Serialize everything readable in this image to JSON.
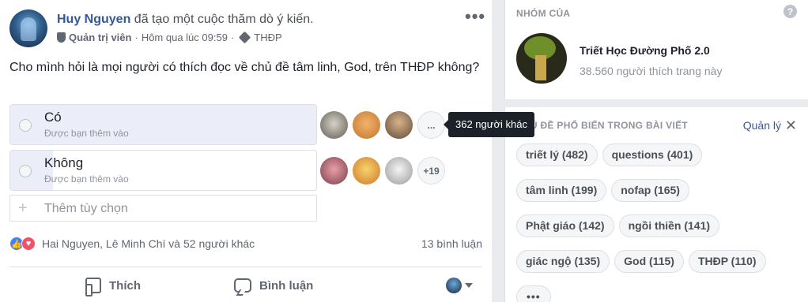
{
  "post": {
    "author": "Huy Nguyen",
    "action": " đã tạo một cuộc thăm dò ý kiến.",
    "role": "Quản trị viên",
    "separator": " · ",
    "time": "Hôm qua lúc 09:59",
    "dot": " · ",
    "tag": "THĐP",
    "more_icon": "•••",
    "question": "Cho mình hỏi là mọi người có thích đọc về chủ đề tâm linh, God, trên THĐP không?"
  },
  "poll": {
    "options": [
      {
        "label": "Có",
        "added_by": "Được bạn thêm vào",
        "more_label": "..."
      },
      {
        "label": "Không",
        "added_by": "Được bạn thêm vào",
        "more_label": "+19"
      }
    ],
    "add_placeholder": "Thêm tùy chọn",
    "add_icon": "+",
    "tooltip": "362 người khác"
  },
  "reactions": {
    "like_glyph": "👍",
    "love_glyph": "♥",
    "names": "Hai Nguyen, Lê Minh Chí và 52 người khác",
    "comments": "13 bình luận"
  },
  "actions": {
    "like": "Thích",
    "comment": "Bình luận"
  },
  "sidebar": {
    "heading": "NHÓM CỦA",
    "help_icon": "?",
    "group_name": "Triết Học Đường Phố 2.0",
    "group_likes": "38.560 người thích trang này",
    "topics_heading": "CHỦ ĐỀ PHỔ BIẾN TRONG BÀI VIẾT",
    "manage": "Quản lý",
    "close_icon": "✕",
    "more_label": "•••",
    "topics": [
      "triết lý (482)",
      "questions (401)",
      "tâm linh (199)",
      "nofap (165)",
      "Phật giáo (142)",
      "ngồi thiền (141)",
      "giác ngộ (135)",
      "God (115)",
      "THĐP (110)"
    ]
  },
  "colors": {
    "link": "#365899",
    "like_blue": "#4080ff",
    "love_red": "#f25268",
    "tooltip_bg": "#1d2129"
  }
}
